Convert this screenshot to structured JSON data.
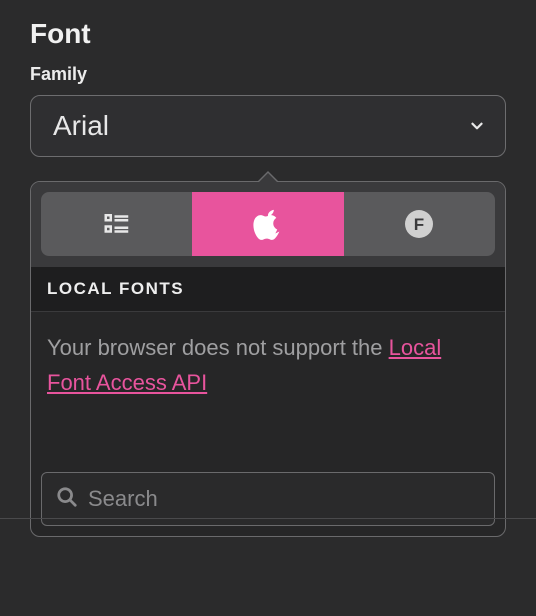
{
  "section": {
    "title": "Font"
  },
  "family": {
    "label": "Family",
    "value": "Arial"
  },
  "popover": {
    "tabs": {
      "list": {
        "name": "list-icon"
      },
      "apple": {
        "name": "apple-icon",
        "active": true
      },
      "f": {
        "name": "f-badge-icon",
        "letter": "F"
      }
    },
    "subheader": "LOCAL FONTS",
    "message": "Your browser does not support the ",
    "link_text": "Local Font Access API",
    "search": {
      "placeholder": "Search",
      "value": ""
    }
  },
  "colors": {
    "accent": "#e8549d"
  }
}
